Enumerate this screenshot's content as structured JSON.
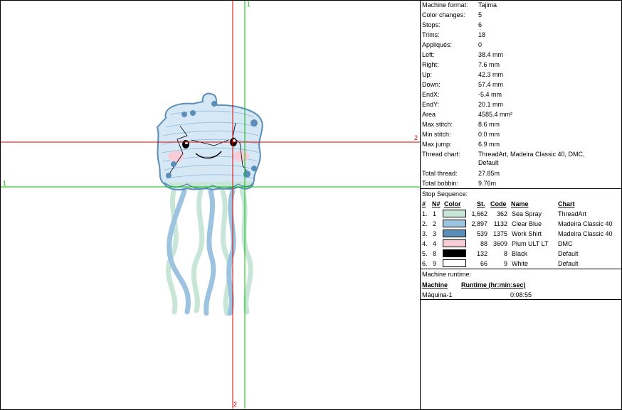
{
  "canvas": {
    "axis_labels": {
      "green_v_top": "1",
      "red_h_right": "2",
      "green_h_left": "1",
      "red_v_bottom": "2"
    },
    "colors": {
      "red_line": "#e00000",
      "green_line": "#00c000"
    }
  },
  "info": [
    {
      "label": "Machine format:",
      "value": "Tajima"
    },
    {
      "label": "Color changes:",
      "value": "5"
    },
    {
      "label": "Stops:",
      "value": "6"
    },
    {
      "label": "Trims:",
      "value": "18"
    },
    {
      "label": "Appliqués:",
      "value": "0"
    },
    {
      "label": "Left:",
      "value": "38.4 mm"
    },
    {
      "label": "Right:",
      "value": "7.6 mm"
    },
    {
      "label": "Up:",
      "value": "42.3 mm"
    },
    {
      "label": "Down:",
      "value": "57.4 mm"
    },
    {
      "label": "EndX:",
      "value": "-5.4 mm"
    },
    {
      "label": "EndY:",
      "value": "20.1 mm"
    },
    {
      "label": "Area",
      "value": "4585.4 mm²"
    },
    {
      "label": "Max stitch:",
      "value": "8.6 mm"
    },
    {
      "label": "Min stitch:",
      "value": "0.0 mm"
    },
    {
      "label": "Max jump:",
      "value": "6.9 mm"
    }
  ],
  "thread_chart": {
    "label": "Thread chart:",
    "value_line1": "ThreadArt, Madeira Classic 40, DMC,",
    "value_line2": "Default"
  },
  "totals": [
    {
      "label": "Total thread:",
      "value": "27.85m"
    },
    {
      "label": "Total bobbin:",
      "value": "9.76m"
    }
  ],
  "stop_sequence": {
    "title": "Stop Sequence:",
    "headers": {
      "num": "#",
      "n": "N#",
      "color": "Color",
      "st": "St.",
      "code": "Code",
      "name": "Name",
      "chart": "Chart"
    },
    "rows": [
      {
        "num": "1.",
        "n": "1",
        "color": "#c8e6d8",
        "st": "1,662",
        "code": "362",
        "name": "Sea Spray",
        "chart": "ThreadArt"
      },
      {
        "num": "2.",
        "n": "2",
        "color": "#9cc3e0",
        "st": "2,897",
        "code": "1132",
        "name": "Clear Blue",
        "chart": "Madeira Classic 40"
      },
      {
        "num": "3.",
        "n": "3",
        "color": "#5a8db8",
        "st": "539",
        "code": "1375",
        "name": "Work Shirt",
        "chart": "Madeira Classic 40"
      },
      {
        "num": "4.",
        "n": "4",
        "color": "#f8cdd8",
        "st": "88",
        "code": "3609",
        "name": "Plum ULT LT",
        "chart": "DMC"
      },
      {
        "num": "5.",
        "n": "8",
        "color": "#000000",
        "st": "132",
        "code": "8",
        "name": "Black",
        "chart": "Default"
      },
      {
        "num": "6.",
        "n": "9",
        "color": "#ffffff",
        "st": "66",
        "code": "9",
        "name": "White",
        "chart": "Default"
      }
    ]
  },
  "runtime": {
    "title": "Machine runtime:",
    "col_machine": "Machine",
    "col_runtime": "Runtime (hr:min:sec)",
    "machine": "Máquina-1",
    "time": "0:08:55"
  }
}
